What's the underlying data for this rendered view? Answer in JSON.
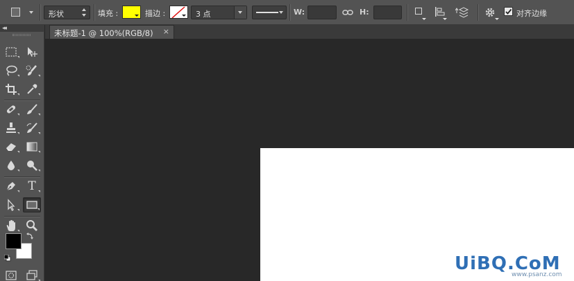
{
  "options_bar": {
    "mode_select": "形状",
    "fill_label": "填充 :",
    "fill_color": "#FFFF00",
    "stroke_label": "描边 :",
    "stroke_color": "none",
    "stroke_width": "3 点",
    "width_label": "W:",
    "width_value": "",
    "height_label": "H:",
    "height_value": "",
    "align_edges_label": "对齐边缘",
    "align_edges_checked": true
  },
  "document": {
    "tab_title": "未标题-1 @ 100%(RGB/8)",
    "close_glyph": "×"
  },
  "toolbox": {
    "collapse_glyph": "◂◂",
    "type_tool_glyph": "T",
    "foreground_color": "#000000",
    "background_color": "#FFFFFF",
    "active_tool": "rectangle-tool"
  },
  "watermark": {
    "main": "UiBQ.CoM",
    "sub": "www.psanz.com"
  },
  "colors": {
    "panel": "#535353",
    "workspace": "#282828",
    "canvas": "#FFFFFF"
  }
}
